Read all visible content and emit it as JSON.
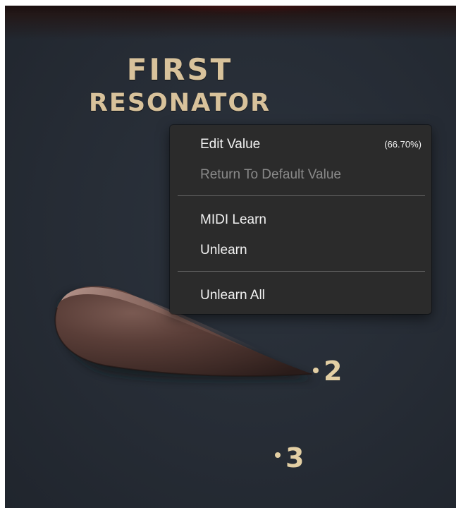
{
  "plugin": {
    "title_line1": "FIRST",
    "title_line2": "RESONATOR",
    "label_color": "#d8c29b"
  },
  "knob": {
    "scale_marks": [
      "2",
      "3"
    ],
    "pointer_color": "#4e3631"
  },
  "context_menu": {
    "items": [
      {
        "label": "Edit Value",
        "extra": "(66.70%)",
        "enabled": true
      },
      {
        "label": "Return To Default Value",
        "enabled": false
      },
      {
        "label": "MIDI Learn",
        "enabled": true
      },
      {
        "label": "Unlearn",
        "enabled": true
      },
      {
        "label": "Unlearn All",
        "enabled": true
      }
    ]
  }
}
